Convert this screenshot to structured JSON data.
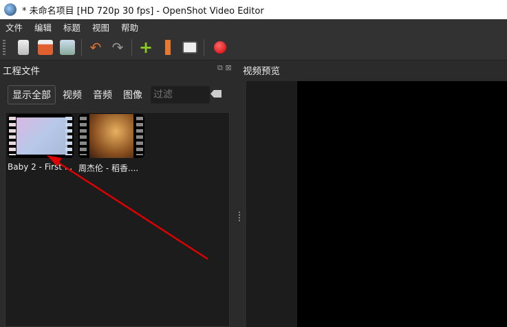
{
  "window": {
    "title": "* 未命名项目 [HD 720p 30 fps] - OpenShot Video Editor"
  },
  "menu": [
    "文件",
    "编辑",
    "标题",
    "视图",
    "帮助"
  ],
  "toolbar": {
    "icons": [
      "new-project-icon",
      "open-project-icon",
      "save-project-icon",
      "undo-icon",
      "redo-icon",
      "import-files-icon",
      "choose-profile-icon",
      "fullscreen-icon",
      "export-video-icon"
    ]
  },
  "project_files": {
    "title": "工程文件",
    "filters": [
      "显示全部",
      "视频",
      "音频",
      "图像"
    ],
    "filter_placeholder": "过滤",
    "items": [
      {
        "label": "Baby 2 - First ..."
      },
      {
        "label": "周杰伦 - 稻香...."
      }
    ]
  },
  "preview": {
    "title": "视频预览"
  },
  "colors": {
    "arrow": "#e00000",
    "background": "#2b2b2b"
  }
}
